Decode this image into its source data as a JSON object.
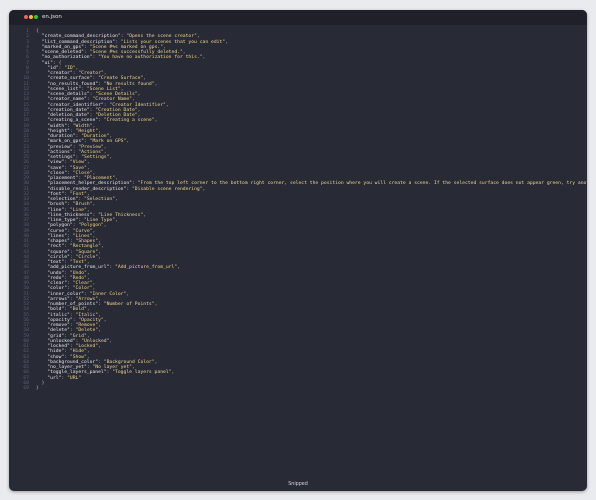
{
  "window": {
    "title": "en.json",
    "footer": "Snipped"
  },
  "colors": {
    "background": "#282a36",
    "key": "#e8e8e8",
    "string": "#f1d78b",
    "line_number": "#5a5d70"
  },
  "code_lines": [
    "{",
    "  \"create_command_description\": \"Opens the scene creator\",",
    "  \"list_command_description\": \"Lists your scenes that you can edit\",",
    "  \"marked_on_gps\": \"Scene #%s marked on gps.\",",
    "  \"scene_deleted\": \"Scene #%s successfully deleted.\",",
    "  \"no_authorization\": \"You have no authorization for this.\",",
    "  \"ui\": {",
    "    \"id\": \"ID\",",
    "    \"creator\": \"Creator\",",
    "    \"create_surface\": \"Create Surface\",",
    "    \"no_results_found\": \"No results found\",",
    "    \"scene_list\": \"Scene List\",",
    "    \"scene_details\": \"Scene Details\",",
    "    \"creator_name\": \"Creator Name\",",
    "    \"creator_identifier\": \"Creator Identifier\",",
    "    \"creation_date\": \"Creation Date\",",
    "    \"deletion_date\": \"Deletion Date\",",
    "    \"creating_a_scene\": \"Creating a scene\",",
    "    \"width\": \"Width\",",
    "    \"height\": \"Height\",",
    "    \"duration\": \"Duration\",",
    "    \"mark_on_gps\": \"Mark on GPS\",",
    "    \"preview\": \"Preview\",",
    "    \"actions\": \"Actions\",",
    "    \"settings\": \"Settings\",",
    "    \"view\": \"View\",",
    "    \"save\": \"Save\",",
    "    \"close\": \"Close\",",
    "    \"placement\": \"Placement\",",
    "    \"placement_helper_description\": \"From the top left corner to the bottom right corner, select the position where you will create a scene. If the selected surface does not appear green, try another location.\",",
    "    \"disable_render_description\": \"Disable scene rendering\",",
    "    \"font\": \"Font\",",
    "    \"selection\": \"Selection\",",
    "    \"brush\": \"Brush\",",
    "    \"line\": \"Line\",",
    "    \"line_thickness\": \"Line Thickness\",",
    "    \"line_type\": \"Line Type\",",
    "    \"polygon\": \"Polygon\",",
    "    \"curve\": \"Curve\",",
    "    \"lines\": \"Lines\",",
    "    \"shapes\": \"Shapes\",",
    "    \"rect\": \"Rectangle\",",
    "    \"square\": \"Square\",",
    "    \"circle\": \"Circle\",",
    "    \"text\": \"Text\",",
    "    \"add_picture_from_url\": \"Add_picture_from_url\",",
    "    \"undo\": \"Undo\",",
    "    \"redo\": \"Redo\",",
    "    \"clear\": \"Clear\",",
    "    \"color\": \"Color\",",
    "    \"inner_color\": \"Inner Color\",",
    "    \"arrows\": \"Arrows\",",
    "    \"number_of_points\": \"Number of Points\",",
    "    \"bold\": \"Bold\",",
    "    \"italic\": \"Italic\",",
    "    \"opacity\": \"Opacity\",",
    "    \"remove\": \"Remove\",",
    "    \"delete\": \"Delete\",",
    "    \"grid\": \"Grid\",",
    "    \"unlocked\": \"Unlocked\",",
    "    \"locked\": \"Locked\",",
    "    \"hide\": \"Hide\",",
    "    \"show\": \"Show\",",
    "    \"background_color\": \"Background Color\",",
    "    \"no_layer_yet\": \"No layer yet\",",
    "    \"toggle_layers_panel\": \"Toggle layers panel\",",
    "    \"url\": \"URL\"",
    "  }",
    "}"
  ]
}
